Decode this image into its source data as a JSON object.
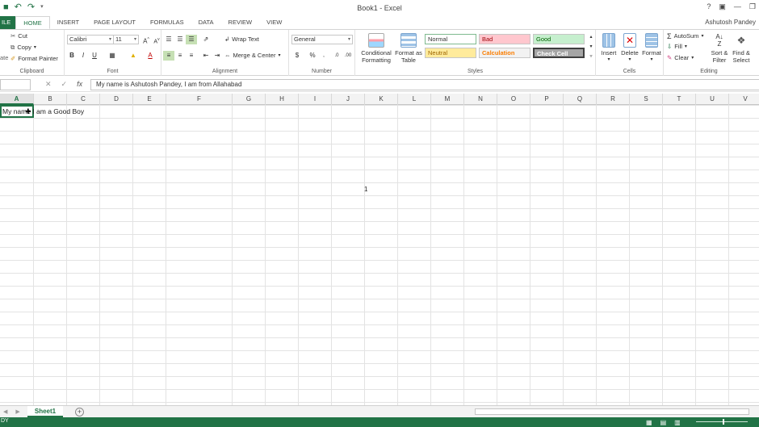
{
  "window": {
    "title": "Book1 - Excel",
    "help": "?",
    "user": "Ashutosh Pandey"
  },
  "tabs": [
    "ILE",
    "HOME",
    "INSERT",
    "PAGE LAYOUT",
    "FORMULAS",
    "DATA",
    "REVIEW",
    "VIEW"
  ],
  "clipboard": {
    "cut": "Cut",
    "copy": "Copy",
    "format_painter": "Format Painter",
    "label": "Clipboard",
    "paste_partial": "ate"
  },
  "font": {
    "name": "Calibri",
    "size": "11",
    "label": "Font"
  },
  "alignment": {
    "wrap": "Wrap Text",
    "merge": "Merge & Center",
    "label": "Alignment"
  },
  "number": {
    "format": "General",
    "label": "Number"
  },
  "styles": {
    "conditional": [
      "Conditional",
      "Formatting"
    ],
    "format_as_table": [
      "Format as",
      "Table"
    ],
    "cells": [
      {
        "name": "Normal",
        "bg": "#ffffff",
        "fg": "#333333",
        "border": "#7fba8f"
      },
      {
        "name": "Bad",
        "bg": "#ffc7ce",
        "fg": "#9c0006"
      },
      {
        "name": "Good",
        "bg": "#c6efce",
        "fg": "#006100"
      },
      {
        "name": "Neutral",
        "bg": "#ffeb9c",
        "fg": "#9c6500"
      },
      {
        "name": "Calculation",
        "bg": "#f2f2f2",
        "fg": "#fa7d00"
      },
      {
        "name": "Check Cell",
        "bg": "#a5a5a5",
        "fg": "#ffffff"
      }
    ],
    "label": "Styles"
  },
  "cells_group": {
    "insert": "Insert",
    "delete": "Delete",
    "format": "Format",
    "label": "Cells"
  },
  "editing": {
    "autosum": "AutoSum",
    "fill": "Fill",
    "clear": "Clear",
    "sort": [
      "Sort &",
      "Filter"
    ],
    "find": [
      "Find &",
      "Select"
    ],
    "label": "Editing"
  },
  "formula_bar": {
    "namebox": "",
    "formula": "My name is Ashutosh Pandey, I am from Allahabad",
    "fx": "fx"
  },
  "columns": [
    "A",
    "B",
    "C",
    "D",
    "E",
    "F",
    "G",
    "H",
    "I",
    "J",
    "K",
    "L",
    "M",
    "N",
    "O",
    "P",
    "Q",
    "R",
    "S",
    "T",
    "U",
    "V"
  ],
  "grid": {
    "a1_text": "My name I am a Good Boy",
    "mid_text": "1"
  },
  "sheets": {
    "active": "Sheet1",
    "add": "+"
  },
  "status": {
    "ready": "DY"
  },
  "colors": {
    "accent": "#217346"
  }
}
